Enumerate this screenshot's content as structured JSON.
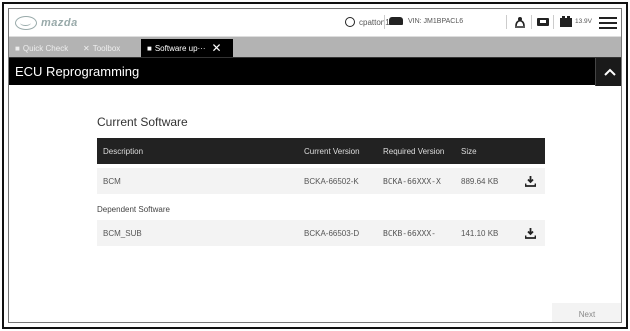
{
  "app": {
    "logo_text": "mazda",
    "user": "cpatton1",
    "vin": "VIN: JM1BPACL6",
    "voltage": "13.9V"
  },
  "tabs": [
    {
      "label": "Quick Check",
      "icon": "car-icon"
    },
    {
      "label": "Toolbox",
      "icon": "tools-icon"
    },
    {
      "label": "Software up···",
      "icon": "square-icon",
      "active": true
    }
  ],
  "header": {
    "title": "ECU Reprogramming"
  },
  "current_software": {
    "title": "Current Software",
    "columns": [
      "Description",
      "Current Version",
      "Required Version",
      "Size"
    ],
    "rows": [
      {
        "description": "BCM",
        "current": "BCKA-66502-K",
        "required": "BCKA-66XXX-X",
        "size": "889.64 KB"
      }
    ]
  },
  "dependent_software": {
    "label": "Dependent Software",
    "rows": [
      {
        "description": "BCM_SUB",
        "current": "BCKA-66503-D",
        "required": "BCKB-66XXX-",
        "size": "141.10 KB"
      }
    ]
  },
  "footer": {
    "next_label": "Next"
  },
  "colors": {
    "header_bg": "#000000",
    "tabbar_bg": "#b3b3b3",
    "table_header_bg": "#222222",
    "row_bg": "#f3f3f3"
  }
}
